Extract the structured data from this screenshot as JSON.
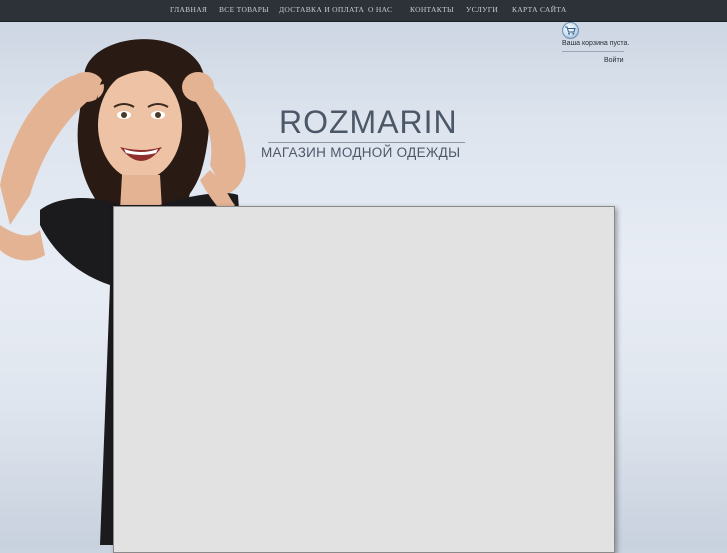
{
  "nav": {
    "items": [
      {
        "label": "ГЛАВНАЯ"
      },
      {
        "label": "ВСЕ ТОВАРЫ"
      },
      {
        "label": "ДОСТАВКА И ОПЛАТА"
      },
      {
        "label": "О НАС"
      },
      {
        "label": "КОНТАКТЫ"
      },
      {
        "label": "УСЛУГИ"
      },
      {
        "label": "КАРТА САЙТА"
      }
    ]
  },
  "cart": {
    "icon": "cart-icon",
    "status": "Ваша корзина пуста."
  },
  "account": {
    "login_label": "Войти"
  },
  "brand": {
    "title": "ROZMARIN",
    "subtitle": "МАГАЗИН МОДНОЙ ОДЕЖДЫ"
  },
  "colors": {
    "nav_bg": "#2d3138",
    "brand_text": "#4c5868",
    "content_bg": "#e2e2e2"
  }
}
